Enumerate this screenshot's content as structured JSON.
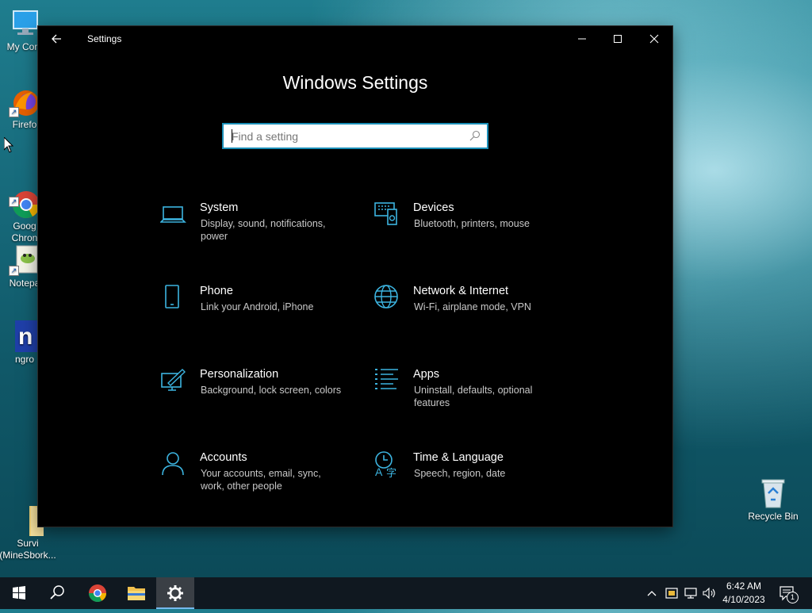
{
  "desktop": {
    "icons": [
      {
        "label": "My Com"
      },
      {
        "label": "Firefo"
      },
      {
        "label": "Goog\nChron"
      },
      {
        "label": "Notepa"
      },
      {
        "label": "ngro"
      },
      {
        "label": "Survi\n(MineSbork..."
      },
      {
        "label": "Recycle Bin"
      }
    ]
  },
  "window": {
    "title": "Settings",
    "heading": "Windows Settings",
    "search": {
      "placeholder": "Find a setting",
      "value": ""
    },
    "tiles": [
      {
        "title": "System",
        "desc": "Display, sound, notifications, power",
        "icon": "laptop-icon"
      },
      {
        "title": "Devices",
        "desc": "Bluetooth, printers, mouse",
        "icon": "devices-icon"
      },
      {
        "title": "Phone",
        "desc": "Link your Android, iPhone",
        "icon": "phone-icon"
      },
      {
        "title": "Network & Internet",
        "desc": "Wi-Fi, airplane mode, VPN",
        "icon": "globe-icon"
      },
      {
        "title": "Personalization",
        "desc": "Background, lock screen, colors",
        "icon": "personalization-icon"
      },
      {
        "title": "Apps",
        "desc": "Uninstall, defaults, optional features",
        "icon": "apps-list-icon"
      },
      {
        "title": "Accounts",
        "desc": "Your accounts, email, sync, work, other people",
        "icon": "person-icon"
      },
      {
        "title": "Time & Language",
        "desc": "Speech, region, date",
        "icon": "time-language-icon"
      }
    ],
    "accent": "#1b8fb8",
    "icon_color": "#3cb4e0"
  },
  "taskbar": {
    "time": "6:42 AM",
    "date": "4/10/2023",
    "notification_count": "1"
  }
}
